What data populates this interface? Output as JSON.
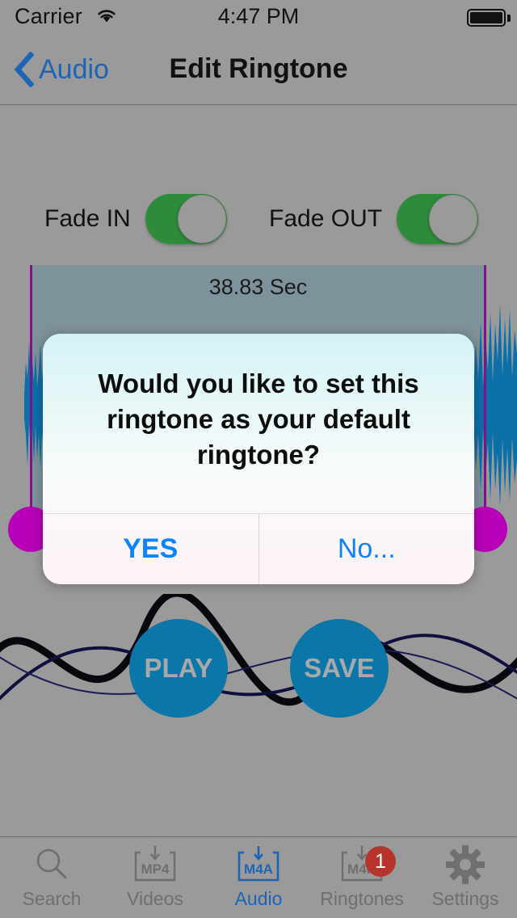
{
  "status_bar": {
    "carrier": "Carrier",
    "time": "4:47 PM",
    "wifi_icon": "wifi-icon",
    "battery_icon": "battery-full-icon"
  },
  "nav_bar": {
    "back_label": "Audio",
    "back_icon": "chevron-left-icon",
    "title": "Edit Ringtone"
  },
  "editor": {
    "fade_in_label": "Fade IN",
    "fade_in_on": true,
    "fade_out_label": "Fade OUT",
    "fade_out_on": true,
    "duration_label": "38.83 Sec",
    "selection_color": "#7e929c",
    "handle_color": "#b700b7",
    "waveform_color": "#0b6fa8",
    "play_label": "PLAY",
    "save_label": "SAVE",
    "button_color": "#0b76a8"
  },
  "dialog": {
    "message": "Would you like to set this ringtone as your default ringtone?",
    "yes_label": "YES",
    "no_label": "No...",
    "accent_color": "#0a84ff"
  },
  "tab_bar": {
    "items": [
      {
        "label": "Search",
        "icon": "search-icon",
        "active": false,
        "badge": ""
      },
      {
        "label": "Videos",
        "icon": "mp4-download-icon",
        "active": false,
        "badge": "",
        "box_text": "MP4"
      },
      {
        "label": "Audio",
        "icon": "m4a-download-icon",
        "active": true,
        "badge": "",
        "box_text": "M4A"
      },
      {
        "label": "Ringtones",
        "icon": "m4r-download-icon",
        "active": false,
        "badge": "1",
        "box_text": "M4R"
      },
      {
        "label": "Settings",
        "icon": "gear-icon",
        "active": false,
        "badge": ""
      }
    ],
    "active_color": "#1b64b8",
    "inactive_color": "#6f6f6f",
    "badge_color": "#b7342c"
  }
}
